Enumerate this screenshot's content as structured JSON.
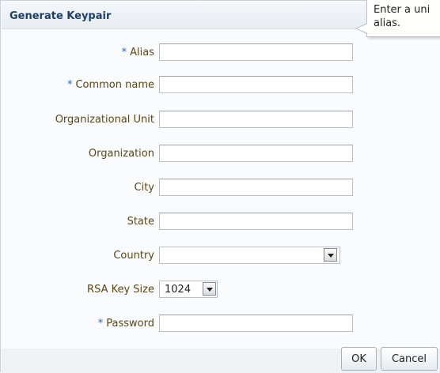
{
  "dialog": {
    "title": "Generate Keypair",
    "tooltip_text": "Enter a uni alias."
  },
  "form": {
    "alias": {
      "label": "Alias",
      "required_mark": "*",
      "value": ""
    },
    "common_name": {
      "label": "Common name",
      "required_mark": "*",
      "value": ""
    },
    "organizational_unit": {
      "label": "Organizational Unit",
      "value": ""
    },
    "organization": {
      "label": "Organization",
      "value": ""
    },
    "city": {
      "label": "City",
      "value": ""
    },
    "state": {
      "label": "State",
      "value": ""
    },
    "country": {
      "label": "Country",
      "selected": ""
    },
    "rsa_key_size": {
      "label": "RSA Key Size",
      "selected": "1024"
    },
    "password": {
      "label": "Password",
      "required_mark": "*",
      "value": ""
    }
  },
  "buttons": {
    "ok_label": "OK",
    "cancel_label": "Cancel"
  },
  "icons": {
    "dropdown": "chevron-down-icon"
  }
}
